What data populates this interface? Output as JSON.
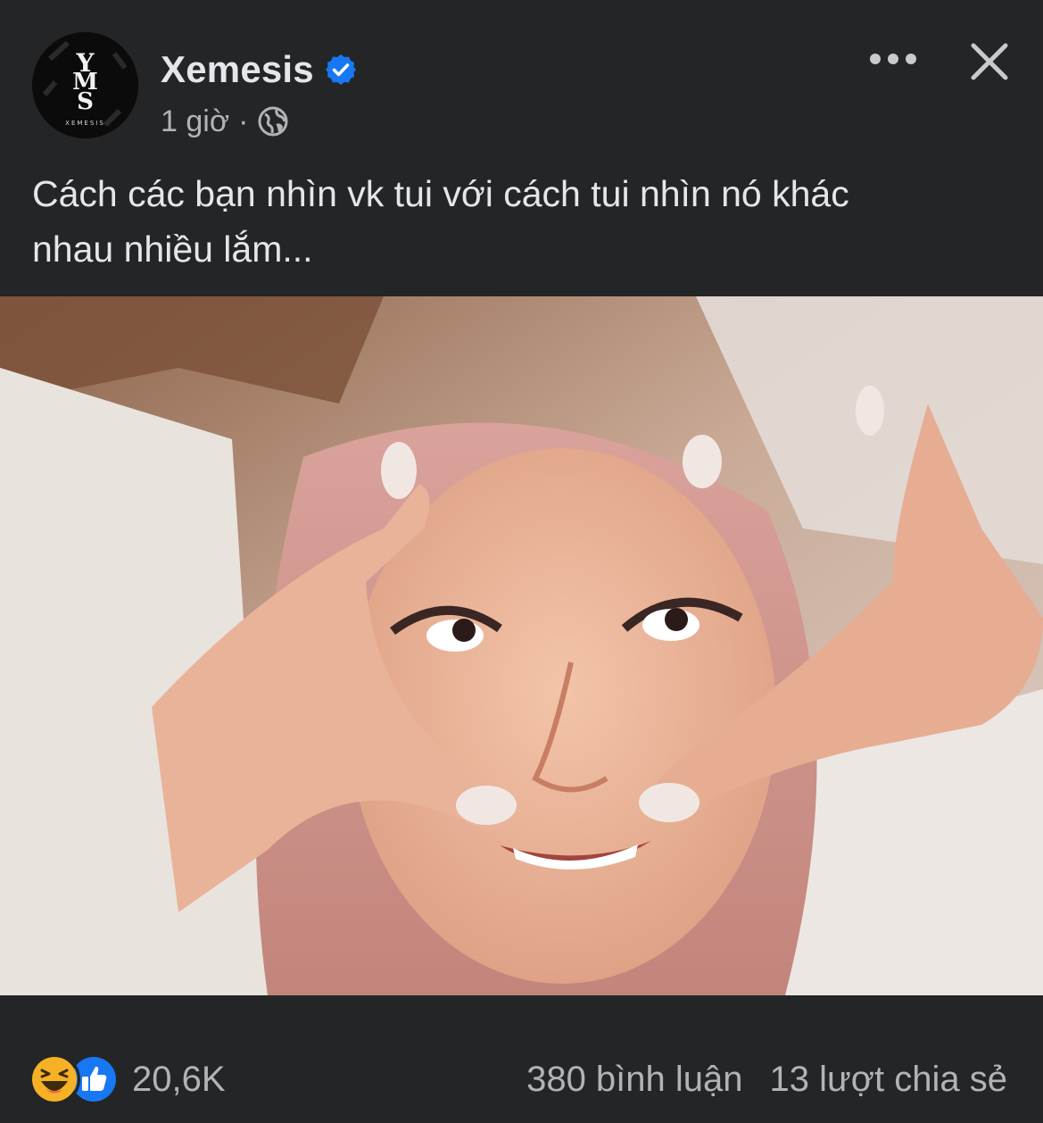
{
  "post": {
    "author": {
      "name": "Xemesis",
      "verified": true,
      "avatar_monogram": "XMS",
      "avatar_wordmark": "XEMESIS"
    },
    "time": "1 giờ",
    "separator": "·",
    "privacy_icon": "globe-icon",
    "caption_line1": "Cách các bạn nhìn vk tui với cách tui nhìn nó khác",
    "caption_line2": "nhau nhiều lắm...",
    "reactions": {
      "icons": [
        "haha-reaction-icon",
        "like-reaction-icon"
      ],
      "count": "20,6K"
    },
    "comments": "380 bình luận",
    "shares": "13 lượt chia sẻ"
  },
  "colors": {
    "background": "#242526",
    "primary_text": "#e4e6eb",
    "secondary_text": "#b0b3b8",
    "verified_badge": "#1877f2",
    "like_blue": "#1877f2",
    "haha_yellow": "#f7b125"
  }
}
